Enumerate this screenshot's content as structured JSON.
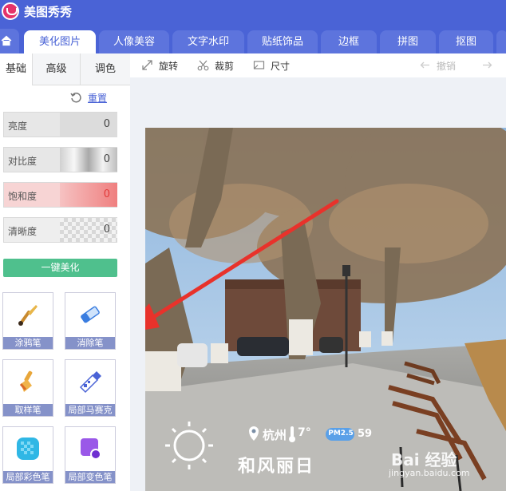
{
  "app": {
    "title": "美图秀秀"
  },
  "tabs": [
    "美化图片",
    "人像美容",
    "文字水印",
    "贴纸饰品",
    "边框",
    "拼图",
    "抠图"
  ],
  "sidebar": {
    "subtabs": [
      "基础",
      "高级",
      "调色"
    ],
    "reset_label": "重置",
    "sliders": [
      {
        "label": "亮度",
        "value": "0"
      },
      {
        "label": "对比度",
        "value": "0"
      },
      {
        "label": "饱和度",
        "value": "0"
      },
      {
        "label": "清晰度",
        "value": "0"
      }
    ],
    "one_click_label": "一键美化",
    "tools": [
      "涂鸦笔",
      "消除笔",
      "取样笔",
      "局部马赛克",
      "局部彩色笔",
      "局部变色笔"
    ]
  },
  "toolbar": {
    "rotate": "旋转",
    "crop": "裁剪",
    "size": "尺寸",
    "undo": "撤销"
  },
  "photo": {
    "location": "杭州",
    "temperature": "7°",
    "pm_badge": "PM2.5",
    "pm_value": "59",
    "weather_text": "和风丽日",
    "watermark": "Bai 经验",
    "watermark_url": "jingyan.baidu.com"
  },
  "colors": {
    "brand_blue": "#4a63d6",
    "tab_inactive": "#5d74dd",
    "button_green": "#4fc08d",
    "tool_label": "#8592c9",
    "arrow_red": "#e8322b"
  }
}
